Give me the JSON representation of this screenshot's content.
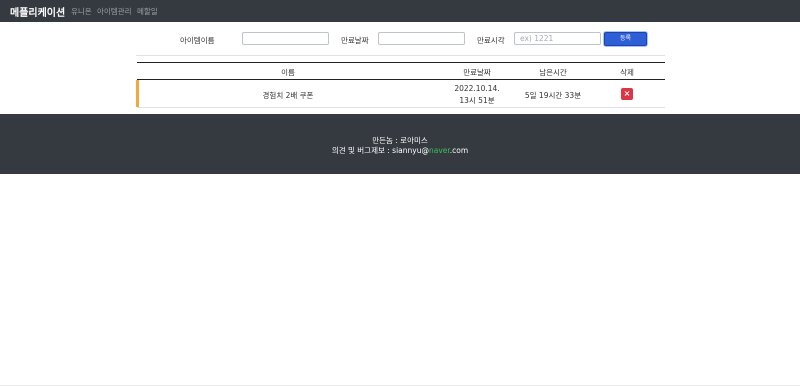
{
  "navbar": {
    "brand": "메플리케이션",
    "links": [
      "유니온",
      "아이템관리",
      "메할일"
    ]
  },
  "form": {
    "item_name_label": "아이템이름",
    "item_name_value": "",
    "expire_date_label": "만료날짜",
    "expire_date_value": "",
    "expire_time_label": "만료시각",
    "expire_time_placeholder": "ex) 1221",
    "submit_label": "등록"
  },
  "table": {
    "headers": [
      "이름",
      "만료날짜",
      "남은시간",
      "삭제"
    ],
    "rows": [
      {
        "name": "경험치 2배 쿠폰",
        "expire_date": "2022.10.14.",
        "expire_time": "13시 51분",
        "remaining": "5일 19시간 33분",
        "delete_label": "×",
        "accent_color": "#f0a93a"
      }
    ]
  },
  "footer": {
    "maker": "만든놈 : 로아미스",
    "contact_prefix": "의견 및 버그제보 : siannyu@",
    "contact_domain": "naver",
    "contact_suffix": ".com"
  },
  "colors": {
    "navbar_bg": "#343a40",
    "primary": "#2f5fd6",
    "danger": "#dc3545",
    "row_accent": "#f0a93a",
    "link_accent": "#3fbf5f"
  }
}
